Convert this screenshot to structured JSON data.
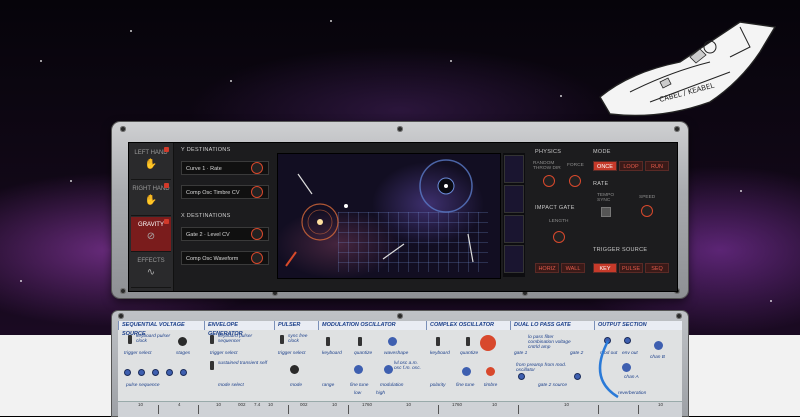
{
  "sidebar": {
    "items": [
      {
        "label": "LEFT HAND",
        "icon": "hand-icon"
      },
      {
        "label": "RIGHT HAND",
        "icon": "hand-icon"
      },
      {
        "label": "GRAVITY",
        "icon": "gravity-icon",
        "active": true
      },
      {
        "label": "EFFECTS",
        "icon": "wave-icon"
      }
    ]
  },
  "y_destinations": {
    "title": "Y DESTINATIONS",
    "rows": [
      "Curve 1 · Rate",
      "Comp Osc Timbre CV"
    ]
  },
  "x_destinations": {
    "title": "X DESTINATIONS",
    "rows": [
      "Gate 2 · Level CV",
      "Comp Osc Waveform"
    ]
  },
  "physics": {
    "title": "PHYSICS",
    "random_throw_dir": "RANDOM THROW DIR",
    "force": "FORCE"
  },
  "impact_gate": {
    "title": "IMPACT GATE",
    "length": "LENGTH",
    "buttons": [
      "HORIZ",
      "WALL"
    ]
  },
  "mode": {
    "title": "MODE",
    "buttons": [
      "ONCE",
      "LOOP",
      "RUN"
    ],
    "selected": "ONCE"
  },
  "rate": {
    "title": "RATE",
    "tempo_sync": "TEMPO SYNC",
    "speed": "SPEED"
  },
  "trigger_source": {
    "title": "TRIGGER SOURCE",
    "buttons": [
      "KEY",
      "PULSE",
      "SEQ"
    ],
    "selected": "KEY"
  },
  "ship": {
    "label": "CABEL / KEABEL"
  },
  "modules": [
    {
      "title": "SEQUENTIAL VOLTAGE SOURCE",
      "lines": [
        "keyboard pulser clock",
        "trigger select",
        "stages",
        "pulse sequence"
      ]
    },
    {
      "title": "ENVELOPE GENERATOR",
      "lines": [
        "keyboard pulser sequencer",
        "trigger select",
        "sustained transient self",
        "mode select"
      ]
    },
    {
      "title": "PULSER",
      "lines": [
        "sync free clock",
        "trigger select",
        "mode"
      ]
    },
    {
      "title": "MODULATION OSCILLATOR",
      "lines": [
        "keyboard",
        "quantize",
        "waveshape",
        "range",
        "fine tune",
        "modulation",
        "low",
        "high",
        "lvl.osc a.m. osc f.m. osc."
      ]
    },
    {
      "title": "COMPLEX OSCILLATOR",
      "lines": [
        "keyboard",
        "quantize",
        "polarity",
        "fine tune",
        "timbre"
      ]
    },
    {
      "title": "DUAL LO PASS GATE",
      "lines": [
        "gate 1",
        "gate 2",
        "lo pass filter combination voltage cntrld amp",
        "from preamp from mod. oscillator",
        "gate 2 source"
      ]
    },
    {
      "title": "OUTPUT SECTION",
      "lines": [
        "mod out",
        "env out",
        "chan A",
        "chan B",
        "reverberation"
      ]
    }
  ],
  "slider_values": [
    "10",
    "4",
    "10",
    "7.4",
    "002",
    "10",
    "002",
    "10",
    "1760",
    "10",
    "1760",
    "10",
    "10",
    "10"
  ],
  "colors": {
    "accent": "#d23a2a",
    "panel_text": "#1b3f8a",
    "screen_bg": "#1c1c1e"
  }
}
